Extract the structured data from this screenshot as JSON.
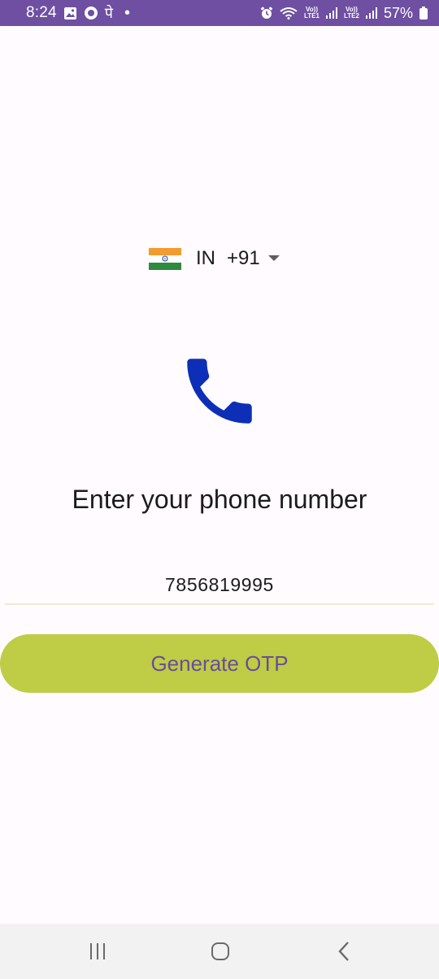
{
  "status_bar": {
    "time": "8:24",
    "indicator_dot": "•",
    "app_char": "पे",
    "lte1_label_top": "Vo))",
    "lte1_label_bottom": "LTE1",
    "lte2_label_top": "Vo))",
    "lte2_label_bottom": "LTE2",
    "battery": "57%",
    "icons": [
      "gallery-icon",
      "circle-app-icon",
      "alarm-icon",
      "wifi-icon",
      "signal-icon",
      "battery-icon"
    ],
    "background": "#6E4FA1"
  },
  "country": {
    "flag": "india-flag-icon",
    "code": "IN",
    "dial": "+91",
    "dropdown_icon": "dropdown-arrow-icon"
  },
  "main": {
    "icon": "phone-icon",
    "icon_color": "#0D2FB8",
    "title": "Enter your phone number",
    "phone_value": "7856819995",
    "button_label": "Generate OTP",
    "button_color": "#BFCC45",
    "button_text_color": "#6A4C9C"
  },
  "nav_bar": {
    "items": [
      "recents-icon",
      "home-icon",
      "back-icon"
    ]
  }
}
